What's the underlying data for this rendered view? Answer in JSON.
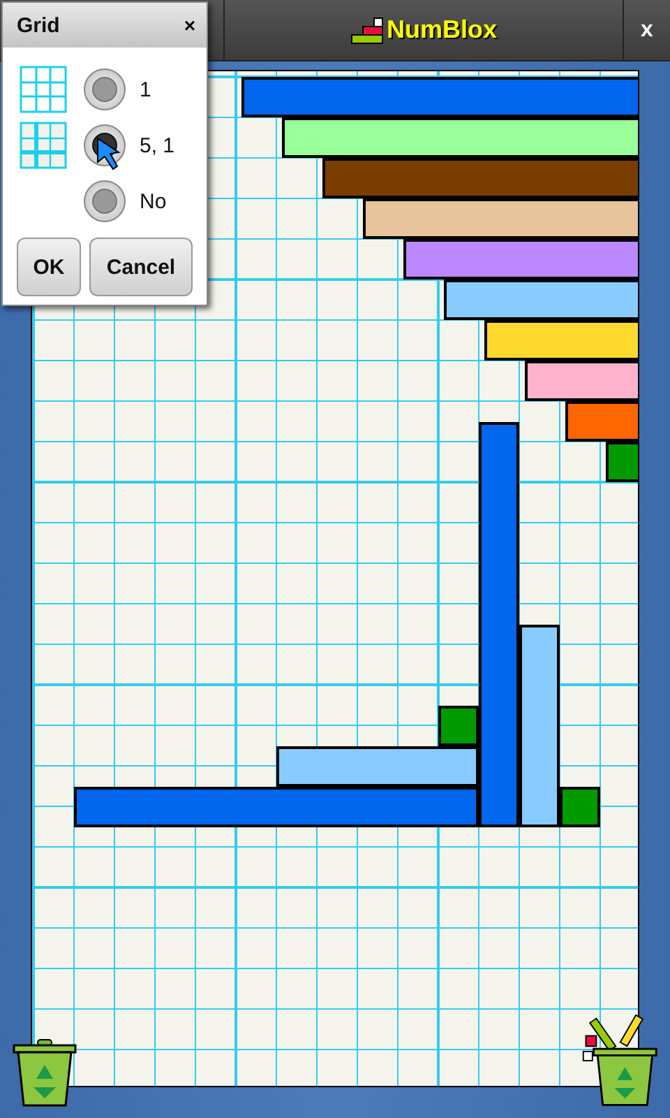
{
  "title_bar": {
    "app_name": "NumBlox",
    "close": "x"
  },
  "rods": [
    {
      "color": "#0066ee"
    },
    {
      "color": "#99ff99"
    },
    {
      "color": "#7a3d00"
    },
    {
      "color": "#e8c49c"
    },
    {
      "color": "#bb88ff"
    },
    {
      "color": "#88ccff"
    },
    {
      "color": "#ffd92e"
    },
    {
      "color": "#ffb3cc"
    },
    {
      "color": "#ff6600"
    },
    {
      "color": "#009900"
    },
    {
      "color": "#0066ee"
    },
    {
      "color": "#0066ee"
    },
    {
      "color": "#88ccff"
    },
    {
      "color": "#88ccff"
    },
    {
      "color": "#009900"
    },
    {
      "color": "#009900"
    }
  ],
  "dialog": {
    "title": "Grid",
    "close": "×",
    "options": [
      {
        "label": "1",
        "selected": false
      },
      {
        "label": "5, 1",
        "selected": true
      },
      {
        "label": "No",
        "selected": false
      }
    ],
    "buttons": [
      "OK",
      "Cancel"
    ]
  }
}
